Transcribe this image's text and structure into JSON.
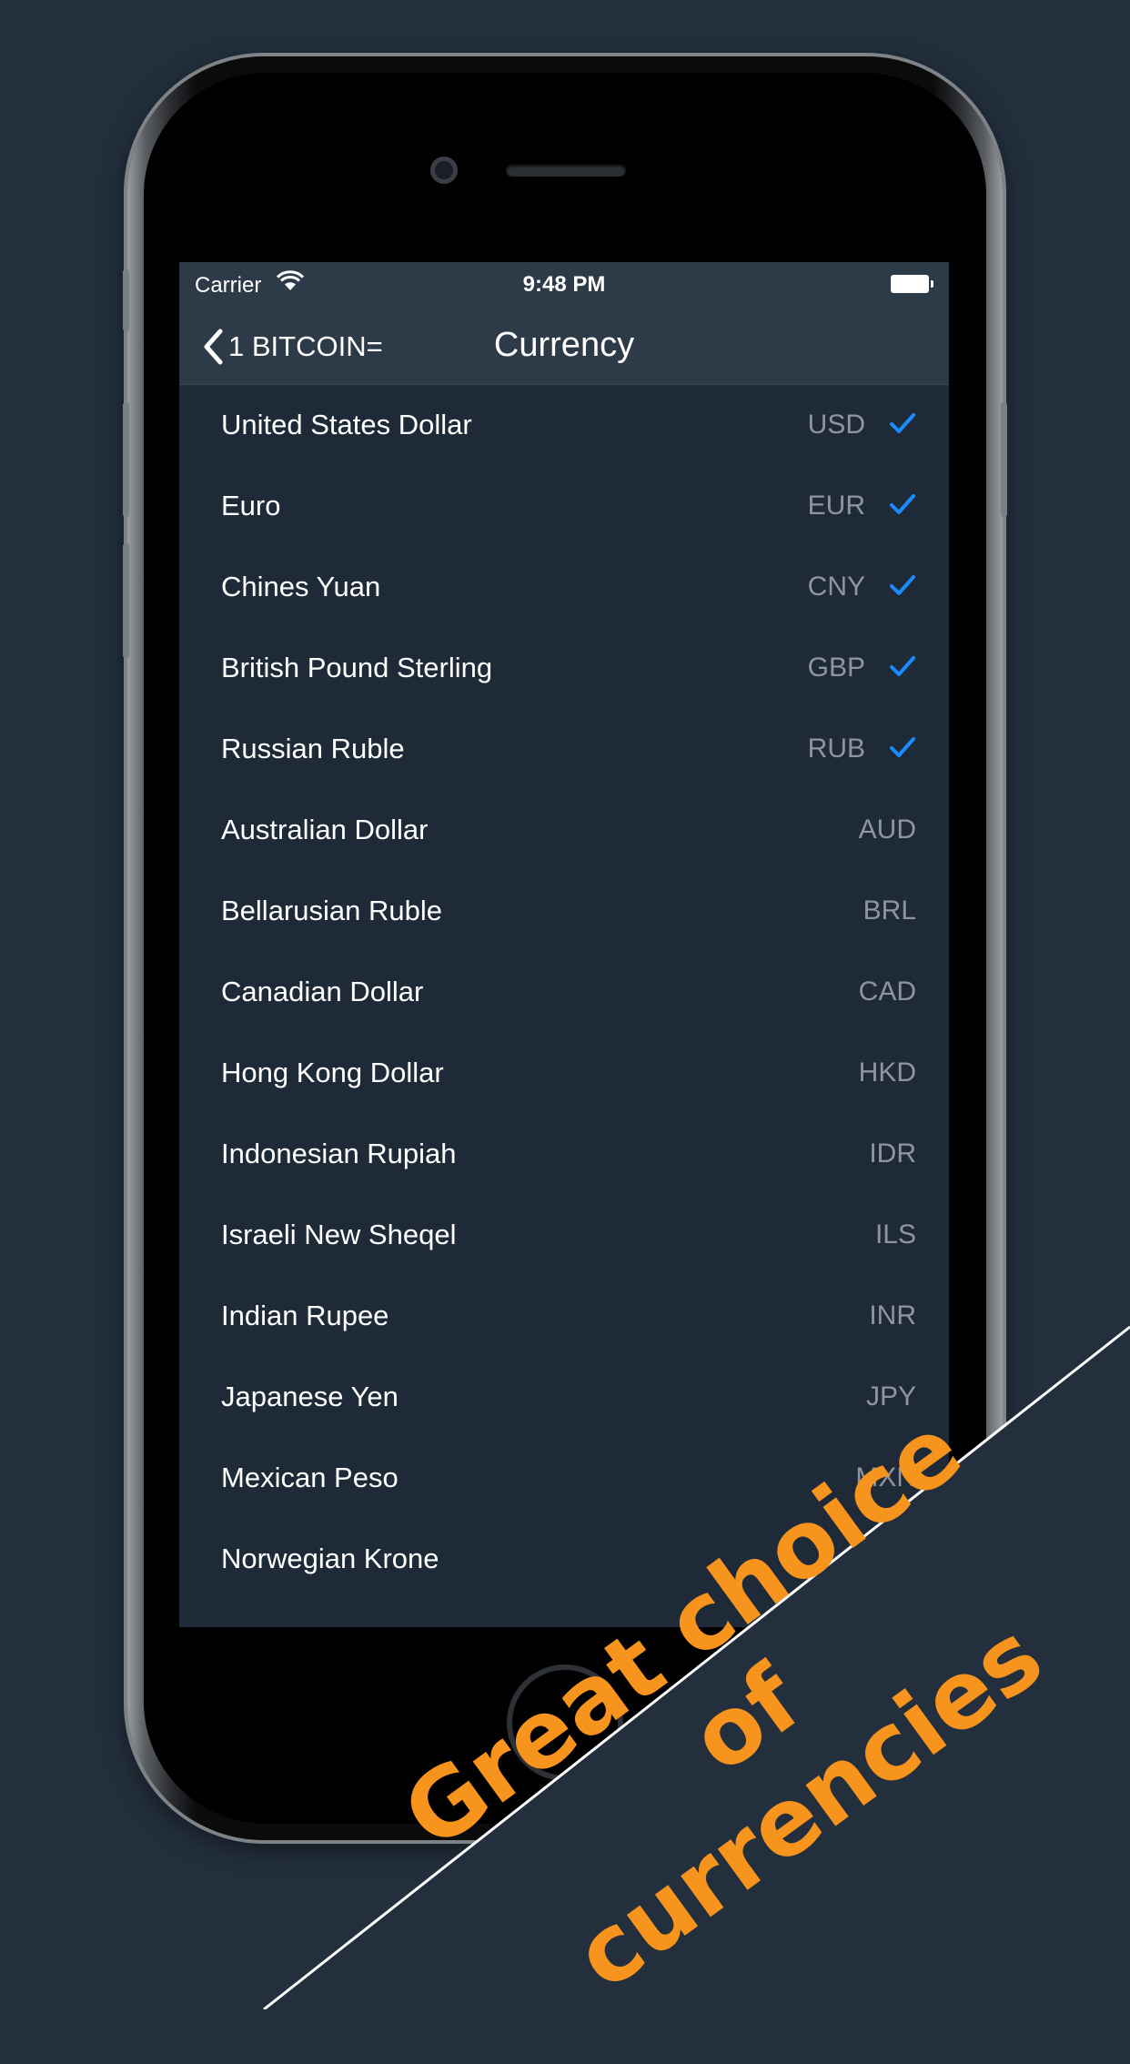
{
  "statusbar": {
    "carrier": "Carrier",
    "time": "9:48 PM"
  },
  "navbar": {
    "back_label": "1 BITCOIN=",
    "title": "Currency"
  },
  "currencies": [
    {
      "name": "United States Dollar",
      "code": "USD",
      "selected": true
    },
    {
      "name": "Euro",
      "code": "EUR",
      "selected": true
    },
    {
      "name": "Chines Yuan",
      "code": "CNY",
      "selected": true
    },
    {
      "name": "British Pound Sterling",
      "code": "GBP",
      "selected": true
    },
    {
      "name": "Russian Ruble",
      "code": "RUB",
      "selected": true
    },
    {
      "name": "Australian Dollar",
      "code": "AUD",
      "selected": false
    },
    {
      "name": "Bellarusian Ruble",
      "code": "BRL",
      "selected": false
    },
    {
      "name": "Canadian Dollar",
      "code": "CAD",
      "selected": false
    },
    {
      "name": "Hong Kong Dollar",
      "code": "HKD",
      "selected": false
    },
    {
      "name": "Indonesian Rupiah",
      "code": "IDR",
      "selected": false
    },
    {
      "name": "Israeli New Sheqel",
      "code": "ILS",
      "selected": false
    },
    {
      "name": "Indian Rupee",
      "code": "INR",
      "selected": false
    },
    {
      "name": "Japanese Yen",
      "code": "JPY",
      "selected": false
    },
    {
      "name": "Mexican Peso",
      "code": "MXN",
      "selected": false
    },
    {
      "name": "Norwegian Krone",
      "code": "",
      "selected": false
    }
  ],
  "banner": {
    "line1": "Great choice of",
    "line2": "currencies"
  },
  "colors": {
    "background": "#232f3d",
    "screen": "#1e2a38",
    "navbar": "#2d3a48",
    "check": "#1a8cff",
    "banner_text": "#f7941d"
  }
}
